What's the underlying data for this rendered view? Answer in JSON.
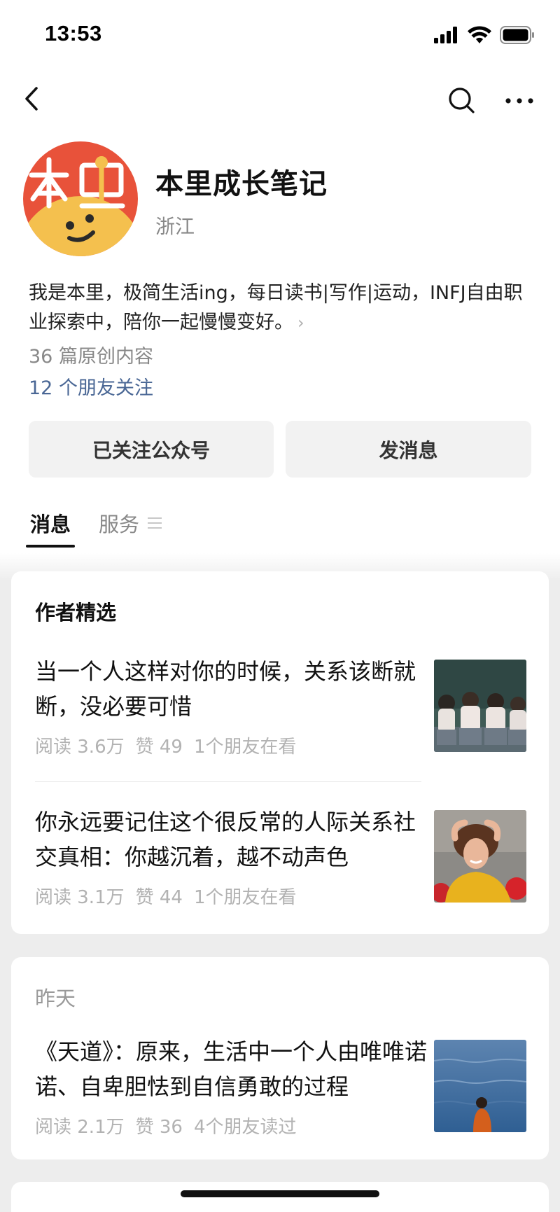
{
  "status_bar": {
    "time": "13:53"
  },
  "profile": {
    "name": "本里成长笔记",
    "region": "浙江",
    "bio": "我是本里，极简生活ing，每日读书|写作|运动，INFJ自由职业探索中，陪你一起慢慢变好。",
    "bio_chevron": "›",
    "article_count": "36 篇原创内容",
    "friends_follow": "12 个朋友关注"
  },
  "buttons": {
    "follow": "已关注公众号",
    "message": "发消息"
  },
  "tabs": {
    "messages": "消息",
    "services": "服务"
  },
  "featured": {
    "header": "作者精选",
    "articles": [
      {
        "title": "当一个人这样对你的时候，关系该断就断，没必要可惜",
        "reads": "阅读 3.6万",
        "likes": "赞 49",
        "friends": "1个朋友在看"
      },
      {
        "title": "你永远要记住这个很反常的人际关系社交真相：你越沉着，越不动声色",
        "reads": "阅读 3.1万",
        "likes": "赞 44",
        "friends": "1个朋友在看"
      }
    ]
  },
  "yesterday": {
    "header": "昨天",
    "articles": [
      {
        "title": "《天道》：原来，生活中一个人由唯唯诺诺、自卑胆怯到自信勇敢的过程",
        "reads": "阅读 2.1万",
        "likes": "赞 36",
        "friends": "4个朋友读过"
      }
    ]
  },
  "icons": {
    "back": "chevron-left-icon",
    "search": "search-icon",
    "more": "more-icon",
    "signal": "signal-icon",
    "wifi": "wifi-icon",
    "battery": "battery-icon"
  },
  "colors": {
    "link": "#4a6795",
    "button_bg": "#f2f2f2",
    "feed_bg": "#ededed",
    "avatar_red": "#e8523a",
    "avatar_yellow": "#f4c04e"
  }
}
